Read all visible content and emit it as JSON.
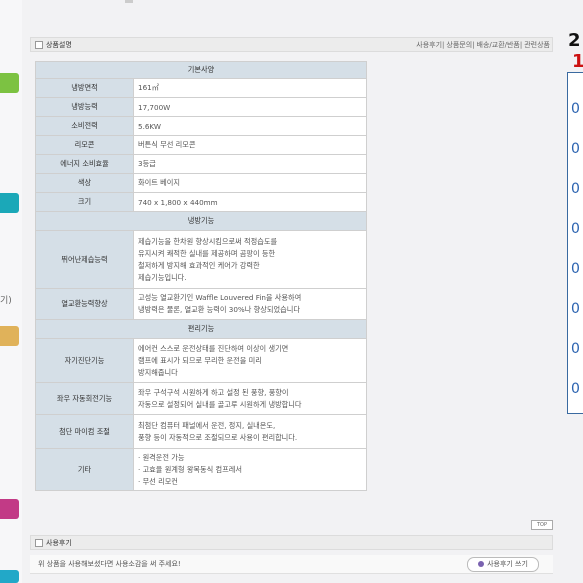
{
  "detail_section": {
    "title": "상품설명",
    "tabs": [
      "사용후기",
      "상품문의",
      "배송/교환/반품",
      "관련상품"
    ]
  },
  "spec_table": {
    "header": "기본사양",
    "rows": [
      {
        "label": "냉방면적",
        "value": "161㎡"
      },
      {
        "label": "냉방능력",
        "value": "17,700W"
      },
      {
        "label": "소비전력",
        "value": "5.6KW"
      },
      {
        "label": "리모콘",
        "value": "버튼식 무선 리모콘"
      },
      {
        "label": "에너지 소비효율",
        "value": "3등급"
      },
      {
        "label": "색상",
        "value": "화이트 베이지"
      },
      {
        "label": "크기",
        "value": "740 x 1,800 x 440mm"
      }
    ],
    "cooling_header": "냉방기능",
    "cooling_rows": [
      {
        "label": "뛰어난제습능력",
        "lines": [
          "제습기능을 한차원 향상시킴으로써 적정습도를",
          "유지시켜 쾌적한 실내를 제공하며 곰팡이 등한",
          "철저하게 방지해 효과적인 케어가 강력한",
          "제습기능입니다."
        ]
      },
      {
        "label": "열교환능력향상",
        "lines": [
          "고성능 열교환기인 Waffle Louvered Fin을 사용하여",
          "냉방력은 물론, 열교환 능력이 30%나 향상되었습니다"
        ]
      }
    ],
    "convenience_header": "편리기능",
    "convenience_rows": [
      {
        "label": "자기진단기능",
        "lines": [
          "에어컨 스스로 운전상태를 진단하여 이상이 생기면",
          "램프에 표시가 되므로 무리한 운전을 미리",
          "방지해줍니다"
        ]
      },
      {
        "label": "좌우 자동회전기능",
        "lines": [
          "좌우 구석구석 시원하게 하고 설정 된 풍향, 풍향이",
          "자동으로 설정되어 실내를 골고루 시원하게 냉방합니다"
        ]
      },
      {
        "label": "첨단 마이컴 조절",
        "lines": [
          "최첨단 컴퓨터 패널에서 운전, 정지, 실내온도,",
          "풍향 등이 자동적으로 조절되므로 사용이 편리합니다."
        ]
      },
      {
        "label": "기타",
        "lines": [
          "· 원격운전 가능",
          "· 고효율 원계형 왕복동식 컴프레서",
          "· 무선 리모컨"
        ]
      }
    ]
  },
  "top_button": "TOP",
  "review_section": {
    "title": "사용후기",
    "prompt": "위 상품을 사용해보셨다면 사용소감을 써 주세요!",
    "write_button": "사용후기 쓰기"
  },
  "left_strip": {
    "label": "기)",
    "colors": [
      "#7cc242",
      "#1ba8b8",
      "#e0b25a",
      "#c23a86",
      "#22a8c8"
    ]
  },
  "right_panel": {
    "top_digit": "2",
    "red_digit": "1",
    "digits": [
      "0",
      "0",
      "0",
      "0",
      "0",
      "0",
      "0",
      "0"
    ],
    "accent": "#2a62b0"
  }
}
